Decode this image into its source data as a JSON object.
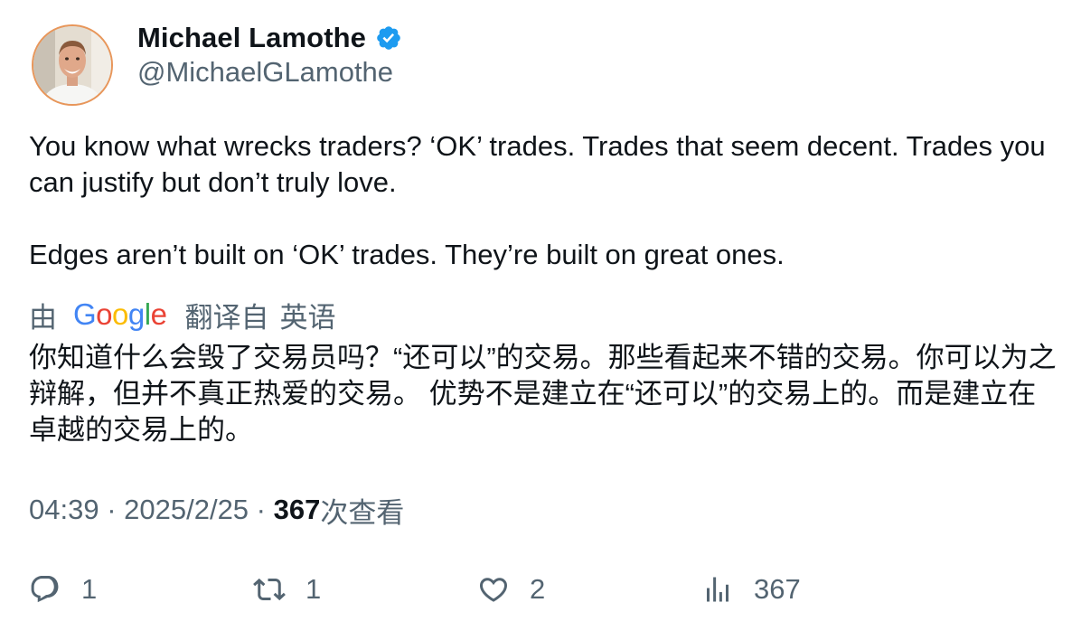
{
  "author": {
    "name": "Michael Lamothe",
    "handle": "@MichaelGLamothe",
    "verified_color": "#1d9bf0"
  },
  "tweet": {
    "paragraph_1": "You know what wrecks traders? ‘OK’ trades. Trades that seem decent. Trades you can justify but don’t truly love.",
    "paragraph_2": "Edges aren’t built on ‘OK’ trades. They’re built on great ones."
  },
  "translation": {
    "prefix": "由",
    "provider": "Google",
    "suffix": "翻译自",
    "language": "英语",
    "text": "你知道什么会毁了交易员吗？“还可以”的交易。那些看起来不错的交易。你可以为之辩解，但并不真正热爱的交易。 优势不是建立在“还可以”的交易上的。而是建立在卓越的交易上的。"
  },
  "meta": {
    "time": "04:39",
    "separator": " · ",
    "date": "2025/2/25",
    "separator2": " · ",
    "views_count": "367",
    "views_label": "次查看"
  },
  "actions": {
    "replies": "1",
    "retweets": "1",
    "likes": "2",
    "views": "367"
  },
  "icons": {
    "reply": "reply-icon",
    "retweet": "retweet-icon",
    "like": "heart-icon",
    "views": "analytics-icon",
    "verified": "verified-badge-icon"
  },
  "colors": {
    "text_primary": "#0f1419",
    "text_secondary": "#536471",
    "accent": "#1d9bf0"
  }
}
